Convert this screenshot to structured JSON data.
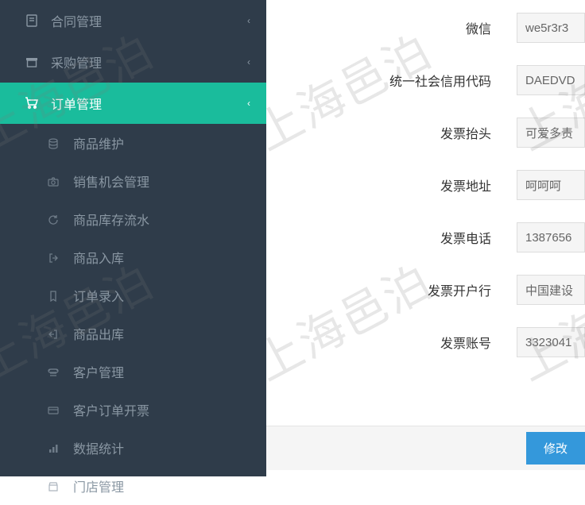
{
  "watermark_text": "上海邑泊",
  "sidebar": {
    "top_items": [
      {
        "label": "合同管理",
        "icon": "file",
        "expanded": false
      },
      {
        "label": "采购管理",
        "icon": "archive",
        "expanded": false
      },
      {
        "label": "订单管理",
        "icon": "cart",
        "expanded": true,
        "active": true
      }
    ],
    "sub_items": [
      {
        "label": "商品维护",
        "icon": "database"
      },
      {
        "label": "销售机会管理",
        "icon": "camera"
      },
      {
        "label": "商品库存流水",
        "icon": "refresh"
      },
      {
        "label": "商品入库",
        "icon": "login"
      },
      {
        "label": "订单录入",
        "icon": "bookmark"
      },
      {
        "label": "商品出库",
        "icon": "logout"
      },
      {
        "label": "客户管理",
        "icon": "phone"
      },
      {
        "label": "客户订单开票",
        "icon": "card"
      },
      {
        "label": "数据统计",
        "icon": "chart"
      },
      {
        "label": "门店管理",
        "icon": "store"
      }
    ]
  },
  "form": {
    "fields": [
      {
        "label": "微信",
        "value": "we5r3r3"
      },
      {
        "label": "统一社会信用代码",
        "value": "DAEDVD"
      },
      {
        "label": "发票抬头",
        "value": "可爱多责"
      },
      {
        "label": "发票地址",
        "value": "呵呵呵"
      },
      {
        "label": "发票电话",
        "value": "1387656"
      },
      {
        "label": "发票开户行",
        "value": "中国建设"
      },
      {
        "label": "发票账号",
        "value": "3323041"
      }
    ],
    "submit_label": "修改"
  }
}
